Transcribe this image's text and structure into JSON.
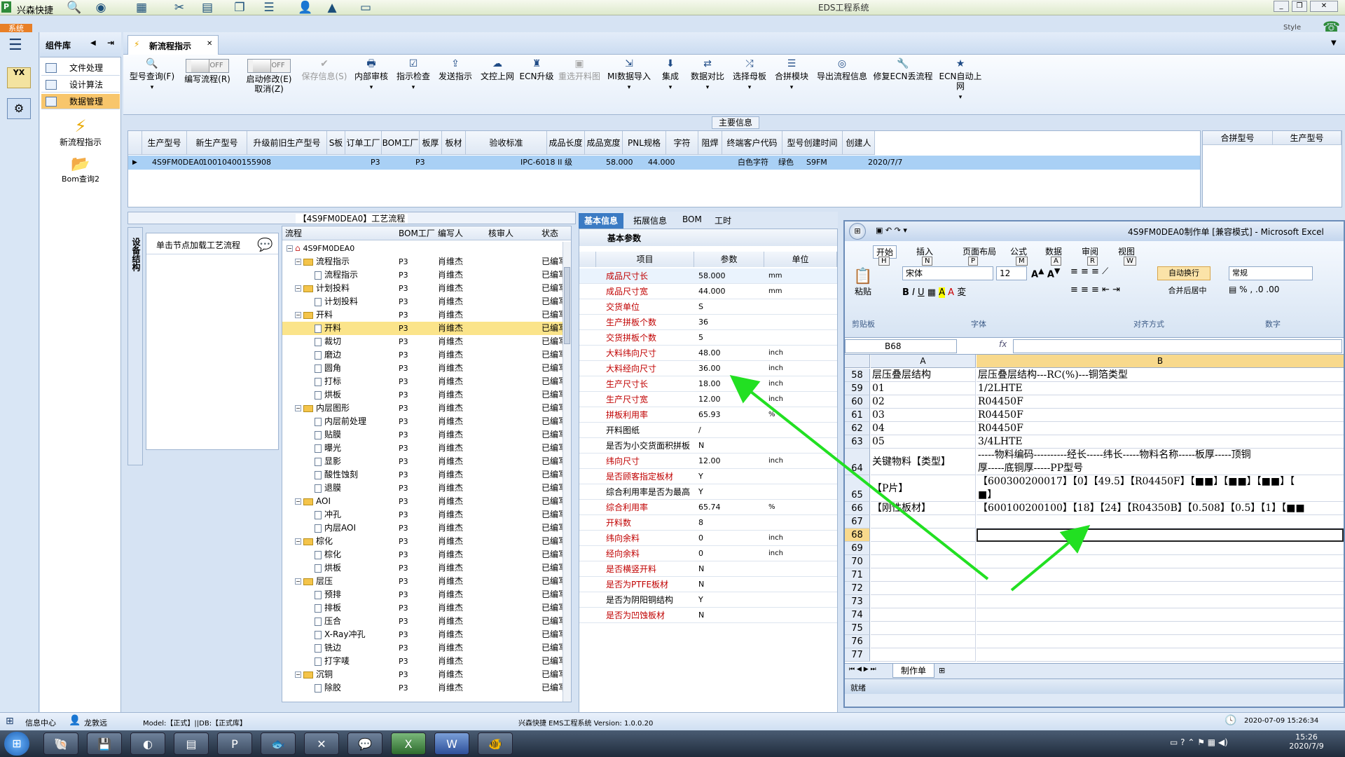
{
  "app": {
    "title": "兴森快捷",
    "window_title": "EDS工程系统",
    "style_label": "Style",
    "system_tab": "系统"
  },
  "sidebar": {
    "header": "组件库",
    "items": [
      {
        "label": "文件处理"
      },
      {
        "label": "设计算法"
      },
      {
        "label": "数据管理"
      }
    ],
    "big_items": [
      {
        "label": "新流程指示"
      },
      {
        "label": "Bom查询2"
      }
    ]
  },
  "tab": {
    "label": "新流程指示"
  },
  "ribbon": {
    "buttons": [
      {
        "label": "型号查询(F)"
      },
      {
        "label": "编写流程(R)",
        "toggle": "OFF"
      },
      {
        "label": "启动修改(E)",
        "sub": "取消(Z)",
        "toggle": "OFF"
      },
      {
        "label": "保存信息(S)"
      },
      {
        "label": "内部审核"
      },
      {
        "label": "指示检查"
      },
      {
        "label": "发送指示"
      },
      {
        "label": "文控上网"
      },
      {
        "label": "ECN升级"
      },
      {
        "label": "重选开料图"
      },
      {
        "label": "MI数据导入"
      },
      {
        "label": "集成"
      },
      {
        "label": "数据对比"
      },
      {
        "label": "选择母板"
      },
      {
        "label": "合拼模块"
      },
      {
        "label": "导出流程信息"
      },
      {
        "label": "修复ECN丢流程"
      },
      {
        "label": "ECN自动上网"
      }
    ]
  },
  "main_info": {
    "title": "主要信息",
    "columns": [
      "生产型号",
      "新生产型号",
      "升级前旧生产型号",
      "S板",
      "订单工厂",
      "BOM工厂",
      "板厚",
      "板材",
      "验收标准",
      "成品长度",
      "成品宽度",
      "PNL规格",
      "字符",
      "阻焊",
      "终端客户代码",
      "型号创建时间",
      "创建人"
    ],
    "row": [
      "4S9FM0DEA0",
      "10010400155908",
      "",
      "",
      "P3",
      "P3",
      "",
      "",
      "IPC-6018 II 级",
      "58.000",
      "44.000",
      "",
      "白色字符",
      "绿色",
      "S9FM",
      "2020/7/7",
      ""
    ],
    "side_columns": [
      "合拼型号",
      "生产型号"
    ]
  },
  "flow": {
    "title": "【4S9FM0DEA0】工艺流程",
    "vertical_tab": "设备结构",
    "hint": "单击节点加载工艺流程",
    "columns": [
      "流程",
      "BOM工厂",
      "编写人",
      "核审人",
      "状态"
    ],
    "root": "4S9FM0DEA0",
    "rows": [
      {
        "name": "流程指示",
        "level": 1,
        "folder": true
      },
      {
        "name": "流程指示",
        "level": 2
      },
      {
        "name": "计划投料",
        "level": 1,
        "folder": true
      },
      {
        "name": "计划投料",
        "level": 2
      },
      {
        "name": "开料",
        "level": 1,
        "folder": true
      },
      {
        "name": "开料",
        "level": 2,
        "selected": true
      },
      {
        "name": "裁切",
        "level": 2
      },
      {
        "name": "磨边",
        "level": 2
      },
      {
        "name": "圆角",
        "level": 2
      },
      {
        "name": "打标",
        "level": 2
      },
      {
        "name": "烘板",
        "level": 2
      },
      {
        "name": "内层图形",
        "level": 1,
        "folder": true
      },
      {
        "name": "内层前处理",
        "level": 2
      },
      {
        "name": "贴膜",
        "level": 2
      },
      {
        "name": "曝光",
        "level": 2
      },
      {
        "name": "显影",
        "level": 2
      },
      {
        "name": "酸性蚀刻",
        "level": 2
      },
      {
        "name": "退膜",
        "level": 2
      },
      {
        "name": "AOI",
        "level": 1,
        "folder": true
      },
      {
        "name": "冲孔",
        "level": 2
      },
      {
        "name": "内层AOI",
        "level": 2
      },
      {
        "name": "棕化",
        "level": 1,
        "folder": true
      },
      {
        "name": "棕化",
        "level": 2
      },
      {
        "name": "烘板",
        "level": 2
      },
      {
        "name": "层压",
        "level": 1,
        "folder": true
      },
      {
        "name": "预排",
        "level": 2
      },
      {
        "name": "排板",
        "level": 2
      },
      {
        "name": "压合",
        "level": 2
      },
      {
        "name": "X-Ray冲孔",
        "level": 2
      },
      {
        "name": "铣边",
        "level": 2
      },
      {
        "name": "打字唛",
        "level": 2
      },
      {
        "name": "沉铜",
        "level": 1,
        "folder": true
      },
      {
        "name": "除胶",
        "level": 2
      }
    ],
    "bom": "P3",
    "writer": "肖维杰",
    "status": "已编写"
  },
  "props": {
    "tabs": [
      "基本信息",
      "拓展信息",
      "BOM",
      "工时"
    ],
    "caption": "基本参数",
    "columns": [
      "项目",
      "参数",
      "单位"
    ],
    "rows": [
      {
        "k": "成品尺寸长",
        "v": "58.000",
        "u": "mm",
        "red": true
      },
      {
        "k": "成品尺寸宽",
        "v": "44.000",
        "u": "mm",
        "red": true
      },
      {
        "k": "交货单位",
        "v": "S",
        "u": "",
        "red": true
      },
      {
        "k": "生产拼板个数",
        "v": "36",
        "u": "",
        "red": true
      },
      {
        "k": "交货拼板个数",
        "v": "5",
        "u": "",
        "red": true
      },
      {
        "k": "大料纬向尺寸",
        "v": "48.00",
        "u": "inch",
        "red": true
      },
      {
        "k": "大料经向尺寸",
        "v": "36.00",
        "u": "inch",
        "red": true
      },
      {
        "k": "生产尺寸长",
        "v": "18.00",
        "u": "inch",
        "red": true
      },
      {
        "k": "生产尺寸宽",
        "v": "12.00",
        "u": "inch",
        "red": true
      },
      {
        "k": "拼板利用率",
        "v": "65.93",
        "u": "%",
        "red": true
      },
      {
        "k": "开料图纸",
        "v": "/",
        "u": "",
        "red": false
      },
      {
        "k": "是否为小交货面积拼板",
        "v": "N",
        "u": "",
        "red": false
      },
      {
        "k": "纬向尺寸",
        "v": "12.00",
        "u": "inch",
        "red": true
      },
      {
        "k": "是否顾客指定板材",
        "v": "Y",
        "u": "",
        "red": true
      },
      {
        "k": "综合利用率是否为最高",
        "v": "Y",
        "u": "",
        "red": false
      },
      {
        "k": "综合利用率",
        "v": "65.74",
        "u": "%",
        "red": true
      },
      {
        "k": "开料数",
        "v": "8",
        "u": "",
        "red": true
      },
      {
        "k": "纬向余料",
        "v": "0",
        "u": "inch",
        "red": true
      },
      {
        "k": "经向余料",
        "v": "0",
        "u": "inch",
        "red": true
      },
      {
        "k": "是否横竖开料",
        "v": "N",
        "u": "",
        "red": true
      },
      {
        "k": "是否为PTFE板材",
        "v": "N",
        "u": "",
        "red": true
      },
      {
        "k": "是否为阴阳铜结构",
        "v": "Y",
        "u": "",
        "red": false
      },
      {
        "k": "是否为凹蚀板材",
        "v": "N",
        "u": "",
        "red": true
      }
    ]
  },
  "excel": {
    "title": "4S9FM0DEA0制作单 [兼容模式] - Microsoft Excel",
    "tabs": [
      "开始",
      "插入",
      "页面布局",
      "公式",
      "数据",
      "审阅",
      "视图"
    ],
    "keytips": [
      "H",
      "N",
      "P",
      "M",
      "A",
      "R",
      "W"
    ],
    "font": "宋体",
    "size": "12",
    "autowrap": "自动换行",
    "merge": "合并后居中",
    "numfmt": "常规",
    "groups": [
      "剪贴板",
      "字体",
      "对齐方式",
      "数字"
    ],
    "paste": "粘贴",
    "namebox": "B68",
    "fx": "fx",
    "col_a": "A",
    "col_b": "B",
    "rows": [
      {
        "n": "58",
        "a": "层压叠层结构",
        "b": "层压叠层结构---RC(%)---铜箔类型"
      },
      {
        "n": "59",
        "a": "01",
        "b": "1/2LHTE"
      },
      {
        "n": "60",
        "a": "02",
        "b": "R04450F"
      },
      {
        "n": "61",
        "a": "03",
        "b": "R04450F"
      },
      {
        "n": "62",
        "a": "04",
        "b": "R04450F"
      },
      {
        "n": "63",
        "a": "05",
        "b": "3/4LHTE"
      },
      {
        "n": "64",
        "a": "关键物料【类型】",
        "b": "-----物料编码----------经长-----纬长-----物料名称-----板厚-----顶铜",
        "b2": "厚-----底铜厚-----PP型号"
      },
      {
        "n": "65",
        "a": "【P片】",
        "b": "【600300200017】【0】【49.5】【R04450F】【■■】【■■】【■■】【",
        "b2": "■】"
      },
      {
        "n": "66",
        "a": "【刚性板材】",
        "b": "【600100200100】【18】【24】【R04350B】【0.508】【0.5】【1】【■■"
      },
      {
        "n": "67",
        "a": "",
        "b": ""
      },
      {
        "n": "68",
        "a": "",
        "b": ""
      },
      {
        "n": "69",
        "a": "",
        "b": ""
      },
      {
        "n": "70",
        "a": "",
        "b": ""
      },
      {
        "n": "71",
        "a": "",
        "b": ""
      },
      {
        "n": "72",
        "a": "",
        "b": ""
      },
      {
        "n": "73",
        "a": "",
        "b": ""
      },
      {
        "n": "74",
        "a": "",
        "b": ""
      },
      {
        "n": "75",
        "a": "",
        "b": ""
      },
      {
        "n": "76",
        "a": "",
        "b": ""
      },
      {
        "n": "77",
        "a": "",
        "b": ""
      }
    ],
    "sheet_tab": "制作单",
    "status": "就绪"
  },
  "status": {
    "info_center": "信息中心",
    "user": "龙敦远",
    "model": "Model:【正式】||DB:【正式库】",
    "version": "兴森快捷 EMS工程系统 Version: 1.0.0.20",
    "datetime": "2020-07-09 15:26:34"
  },
  "taskbar": {
    "time": "15:26",
    "date": "2020/7/9"
  },
  "colors": {
    "accent": "#3b7bc4",
    "arrow": "#22e022",
    "selected_row": "#a9d0f5",
    "red_text": "#c00000"
  }
}
